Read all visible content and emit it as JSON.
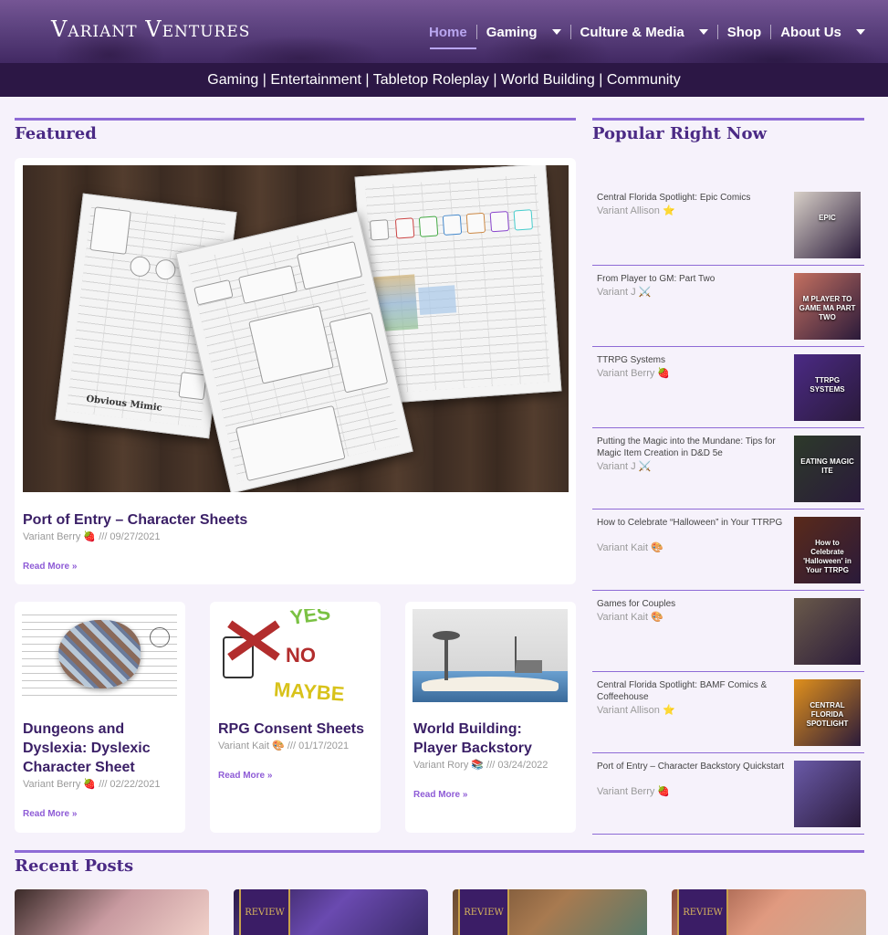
{
  "site": {
    "logo": "Variant Ventures"
  },
  "nav": [
    {
      "label": "Home",
      "dropdown": false
    },
    {
      "label": "Gaming",
      "dropdown": true
    },
    {
      "label": "Culture & Media",
      "dropdown": true
    },
    {
      "label": "Shop",
      "dropdown": false
    },
    {
      "label": "About Us",
      "dropdown": true
    }
  ],
  "tagline": "Gaming | Entertainment | Tabletop Roleplay | World Building | Community",
  "featured": {
    "heading": "Featured",
    "main": {
      "title": "Port of Entry – Character Sheets",
      "author": "Variant Berry 🍓",
      "date": "/// 09/27/2021",
      "read_more": "Read More »",
      "image_brand": "Obvious Mimic"
    },
    "cards": [
      {
        "title": "Dungeons and Dyslexia: Dyslexic Character Sheet",
        "author": "Variant Berry 🍓",
        "date": "/// 02/22/2021",
        "read_more": "Read More »"
      },
      {
        "title": "RPG Consent Sheets",
        "author": "Variant Kait 🎨",
        "date": "/// 01/17/2021",
        "read_more": "Read More »",
        "image_words": [
          "YES",
          "NO",
          "MAYBE"
        ]
      },
      {
        "title": "World Building: Player Backstory",
        "author": "Variant Rory 📚",
        "date": "/// 03/24/2022",
        "read_more": "Read More »"
      }
    ]
  },
  "popular": {
    "heading": "Popular Right Now",
    "items": [
      {
        "title": "Central Florida Spotlight: Epic Comics",
        "author": "Variant Allison ⭐",
        "image_text": "EPIC",
        "color": "#d8d0c8"
      },
      {
        "title": "From Player to GM: Part Two",
        "author": "Variant J ⚔️",
        "image_text": "M PLAYER TO GAME MA PART TWO",
        "color": "#c47060"
      },
      {
        "title": "TTRPG Systems",
        "author": "Variant Berry 🍓",
        "image_text": "TTRPG SYSTEMS",
        "color": "#4b2a85"
      },
      {
        "title": "Putting the Magic into the Mundane: Tips for Magic Item Creation in D&D 5e",
        "author": "Variant J ⚔️",
        "image_text": "EATING MAGIC ITE",
        "color": "#2d3a2a"
      },
      {
        "title": "How to Celebrate “Halloween” in Your TTRPG",
        "author": "Variant Kait 🎨",
        "image_text": "How to Celebrate 'Halloween' in Your TTRPG",
        "color": "#5a2a1a"
      },
      {
        "title": "Games for Couples",
        "author": "Variant Kait 🎨",
        "image_text": "",
        "color": "#6a5a4a"
      },
      {
        "title": "Central Florida Spotlight: BAMF Comics & Coffeehouse",
        "author": "Variant Allison ⭐",
        "image_text": "CENTRAL FLORIDA SPOTLIGHT",
        "color": "#e0901c"
      },
      {
        "title": "Port of Entry – Character Backstory Quickstart",
        "author": "Variant Berry 🍓",
        "image_text": "",
        "color": "#6a5aa8"
      }
    ]
  },
  "recent": {
    "heading": "Recent Posts",
    "ribbon": "REVIEW"
  }
}
